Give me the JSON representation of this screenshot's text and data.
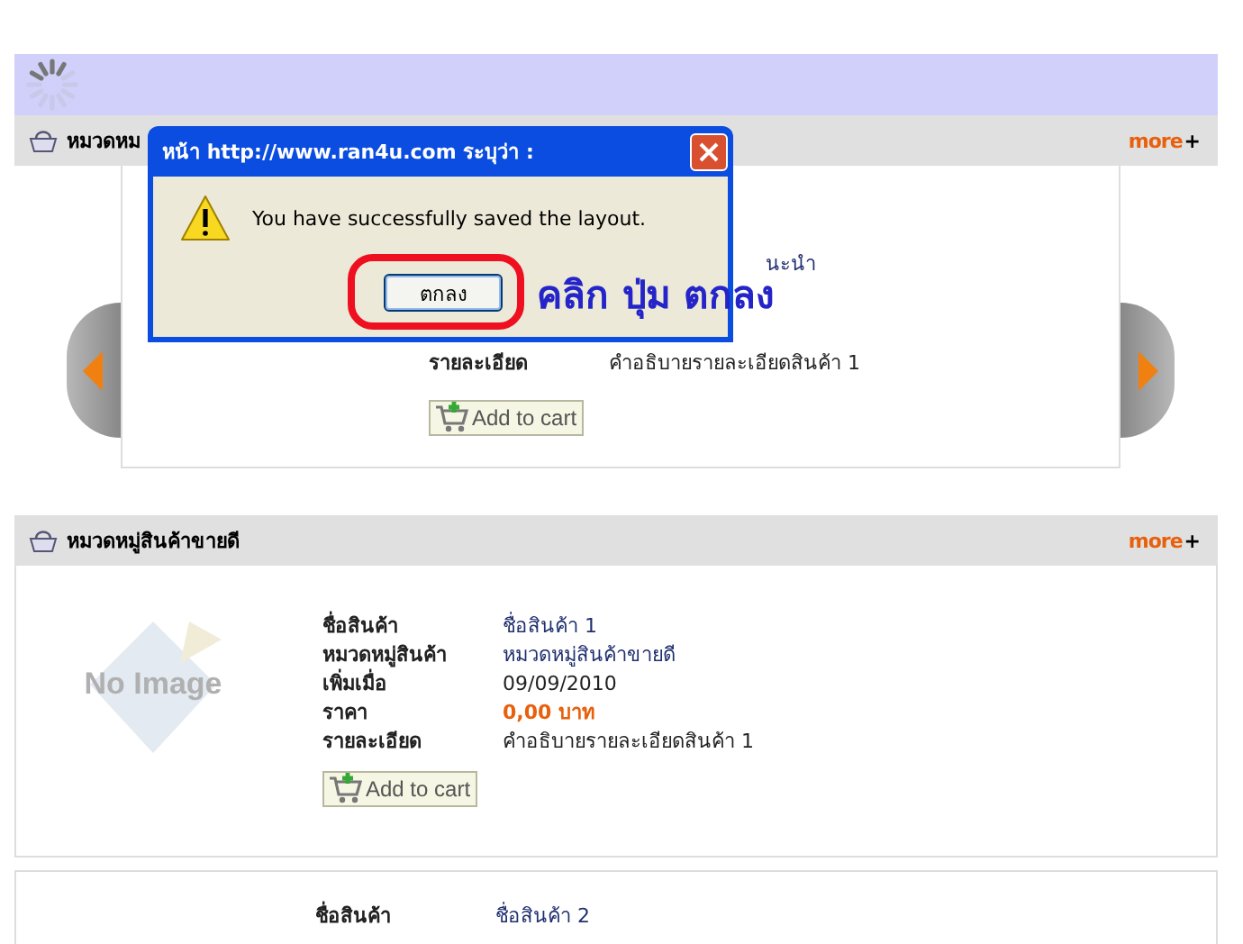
{
  "featured_section": {
    "title": "หมวดหม",
    "more_link": "more",
    "more_plus": "+",
    "partial_value": "นะนำ",
    "detail_label": "รายละเอียด",
    "detail_value": "คำอธิบายรายละเอียดสินค้า 1",
    "add_to_cart": "Add to cart"
  },
  "bestseller_section": {
    "title": "หมวดหมู่สินค้าขายดี",
    "more_link": "more",
    "more_plus": "+",
    "image_text": "No Image",
    "fields": [
      {
        "label": "ชื่อสินค้า",
        "value": "ชื่อสินค้า 1",
        "kind": "link"
      },
      {
        "label": "หมวดหมู่สินค้า",
        "value": "หมวดหมู่สินค้าขายดี",
        "kind": "link"
      },
      {
        "label": "เพิ่มเมื่อ",
        "value": "09/09/2010",
        "kind": "plain"
      },
      {
        "label": "ราคา",
        "value": "0,00 บาท",
        "kind": "price"
      },
      {
        "label": "รายละเอียด",
        "value": "คำอธิบายรายละเอียดสินค้า 1",
        "kind": "plain"
      }
    ],
    "add_to_cart": "Add to cart"
  },
  "next_product": {
    "label": "ชื่อสินค้า",
    "value": "ชื่อสินค้า 2"
  },
  "dialog": {
    "title": "หน้า http://www.ran4u.com ระบุว่า :",
    "message": "You have successfully saved the layout.",
    "ok_button": "ตกลง"
  },
  "annotation": "คลิก ปุ่ม ตกลง"
}
